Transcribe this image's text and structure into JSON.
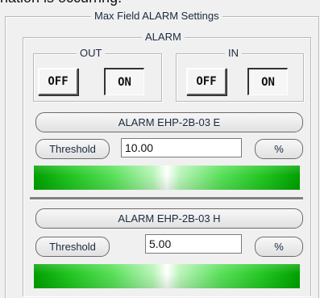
{
  "top_fragment": "nation is occurring.",
  "settings_group": {
    "title": "Max Field ALARM Settings"
  },
  "alarm_group": {
    "title": "ALARM",
    "out": {
      "title": "OUT",
      "off_label": "OFF",
      "on_label": "ON",
      "selected": "ON"
    },
    "in": {
      "title": "IN",
      "off_label": "OFF",
      "on_label": "ON",
      "selected": "ON"
    }
  },
  "alarms": [
    {
      "name": "ALARM EHP-2B-03 E",
      "threshold_label": "Threshold",
      "threshold_value": "10.00",
      "unit_label": "%"
    },
    {
      "name": "ALARM EHP-2B-03 H",
      "threshold_label": "Threshold",
      "threshold_value": "5.00",
      "unit_label": "%"
    }
  ],
  "colors": {
    "level_bar": "#00a000",
    "background": "#f0f0f0"
  }
}
